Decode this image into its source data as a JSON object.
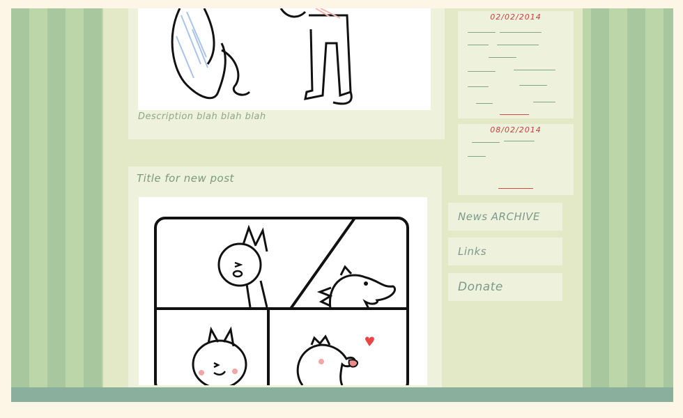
{
  "posts": [
    {
      "description": "Description blah blah blah"
    },
    {
      "title": "Title for new post"
    }
  ],
  "news": [
    {
      "date": "02/02/2014"
    },
    {
      "date": "08/02/2014"
    }
  ],
  "nav": {
    "news_archive": "News ARCHIVE",
    "links": "Links",
    "donate": "Donate"
  },
  "colors": {
    "page_background": "#fdf6e6",
    "stripe_light": "#bdd6a9",
    "stripe_dark": "#a9c79f",
    "content_background": "#e3e8c6",
    "panel_background": "#eef1dc",
    "date_red": "#c2403e",
    "footer_bar": "#8aaf9c"
  }
}
